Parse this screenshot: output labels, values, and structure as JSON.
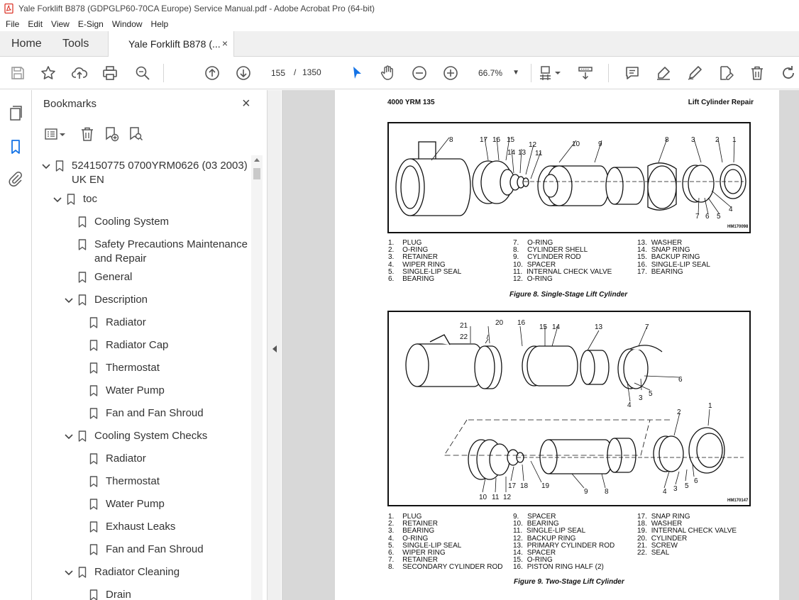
{
  "window": {
    "title": "Yale Forklift B878 (GDPGLP60-70CA Europe) Service Manual.pdf - Adobe Acrobat Pro (64-bit)"
  },
  "menu": [
    "File",
    "Edit",
    "View",
    "E-Sign",
    "Window",
    "Help"
  ],
  "tabs": {
    "home": "Home",
    "tools": "Tools",
    "document": "Yale Forklift B878 (...",
    "close": "×"
  },
  "toolbar": {
    "current_page": "155",
    "page_separator": "/",
    "total_pages": "1350",
    "zoom": "66.7%"
  },
  "bookmarks_panel": {
    "title": "Bookmarks",
    "close": "×",
    "items": [
      {
        "label": "524150775 0700YRM0626 (03 2003) UK EN",
        "level": 0,
        "expanded": true
      },
      {
        "label": "toc",
        "level": 1,
        "expanded": true
      },
      {
        "label": "Cooling System",
        "level": 2
      },
      {
        "label": "Safety Precautions Maintenance and Repair",
        "level": 2
      },
      {
        "label": "General",
        "level": 2
      },
      {
        "label": "Description",
        "level": 2,
        "expanded": true
      },
      {
        "label": "Radiator",
        "level": 3
      },
      {
        "label": "Radiator Cap",
        "level": 3
      },
      {
        "label": "Thermostat",
        "level": 3
      },
      {
        "label": "Water Pump",
        "level": 3
      },
      {
        "label": "Fan and Fan Shroud",
        "level": 3
      },
      {
        "label": "Cooling System Checks",
        "level": 2,
        "expanded": true
      },
      {
        "label": "Radiator",
        "level": 3
      },
      {
        "label": "Thermostat",
        "level": 3
      },
      {
        "label": "Water Pump",
        "level": 3
      },
      {
        "label": "Exhaust Leaks",
        "level": 3
      },
      {
        "label": "Fan and Fan Shroud",
        "level": 3
      },
      {
        "label": "Radiator Cleaning",
        "level": 2,
        "expanded": true
      },
      {
        "label": "Drain",
        "level": 3
      }
    ]
  },
  "document": {
    "header_left": "4000 YRM 135",
    "header_right": "Lift Cylinder Repair",
    "figure8": {
      "code": "HM170098",
      "caption": "Figure 8.  Single-Stage Lift Cylinder",
      "callouts": [
        "8",
        "17",
        "16",
        "15",
        "14",
        "13",
        "12",
        "11",
        "10",
        "9",
        "8",
        "3",
        "2",
        "1",
        "7",
        "6",
        "5",
        "4"
      ],
      "parts": [
        [
          "1.",
          "PLUG"
        ],
        [
          "2.",
          "O-RING"
        ],
        [
          "3.",
          "RETAINER"
        ],
        [
          "4.",
          "WIPER RING"
        ],
        [
          "5.",
          "SINGLE-LIP SEAL"
        ],
        [
          "6.",
          "BEARING"
        ],
        [
          "7.",
          "O-RING"
        ],
        [
          "8.",
          "CYLINDER SHELL"
        ],
        [
          "9.",
          "CYLINDER ROD"
        ],
        [
          "10.",
          "SPACER"
        ],
        [
          "11.",
          "INTERNAL CHECK VALVE"
        ],
        [
          "12.",
          "O-RING"
        ],
        [
          "13.",
          "WASHER"
        ],
        [
          "14.",
          "SNAP RING"
        ],
        [
          "15.",
          "BACKUP RING"
        ],
        [
          "16.",
          "SINGLE-LIP SEAL"
        ],
        [
          "17.",
          "BEARING"
        ]
      ]
    },
    "figure9": {
      "code": "HM170147",
      "caption": "Figure 9.  Two-Stage Lift Cylinder",
      "callouts": [
        "21",
        "20",
        "16",
        "15",
        "14",
        "13",
        "7",
        "22",
        "6",
        "5",
        "3",
        "4",
        "2",
        "1",
        "17",
        "18",
        "19",
        "9",
        "8",
        "6",
        "5",
        "4",
        "3",
        "10",
        "11",
        "12"
      ],
      "parts": [
        [
          "1.",
          "PLUG"
        ],
        [
          "2.",
          "RETAINER"
        ],
        [
          "3.",
          "BEARING"
        ],
        [
          "4.",
          "O-RING"
        ],
        [
          "5.",
          "SINGLE-LIP SEAL"
        ],
        [
          "6.",
          "WIPER RING"
        ],
        [
          "7.",
          "RETAINER"
        ],
        [
          "8.",
          "SECONDARY CYLINDER ROD"
        ],
        [
          "9.",
          "SPACER"
        ],
        [
          "10.",
          "BEARING"
        ],
        [
          "11.",
          "SINGLE-LIP SEAL"
        ],
        [
          "12.",
          "BACKUP RING"
        ],
        [
          "13.",
          "PRIMARY CYLINDER ROD"
        ],
        [
          "14.",
          "SPACER"
        ],
        [
          "15.",
          "O-RING"
        ],
        [
          "16.",
          "PISTON RING HALF (2)"
        ],
        [
          "17.",
          "SNAP RING"
        ],
        [
          "18.",
          "WASHER"
        ],
        [
          "19.",
          "INTERNAL CHECK VALVE"
        ],
        [
          "20.",
          "CYLINDER"
        ],
        [
          "21.",
          "SCREW"
        ],
        [
          "22.",
          "SEAL"
        ]
      ]
    }
  },
  "colors": {
    "acrobat_red": "#d9281c",
    "active_blue": "#1473e6",
    "icon_gray": "#555555"
  }
}
